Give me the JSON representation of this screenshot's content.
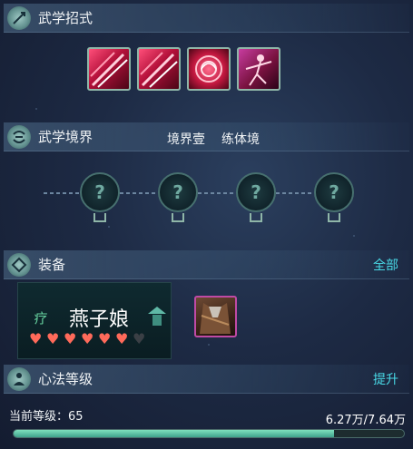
{
  "sections": {
    "martial": {
      "title": "武学招式",
      "icon": "sword-icon"
    },
    "realm": {
      "title": "武学境界",
      "icon": "swirl-icon",
      "realm_name": "境界壹",
      "realm_stage": "练体境"
    },
    "equip": {
      "title": "装备",
      "icon": "emblem-icon",
      "link": "全部"
    },
    "mind": {
      "title": "心法等级",
      "icon": "meditation-icon",
      "link": "提升"
    }
  },
  "skills": [
    {
      "icon": "slash-skill-icon"
    },
    {
      "icon": "slash-skill-icon"
    },
    {
      "icon": "rose-skill-icon"
    },
    {
      "icon": "dancer-skill-icon"
    }
  ],
  "realm_nodes": [
    {
      "icon": "locked-node-icon",
      "glyph": "?"
    },
    {
      "icon": "locked-node-icon",
      "glyph": "?"
    },
    {
      "icon": "locked-node-icon",
      "glyph": "?"
    },
    {
      "icon": "locked-node-icon",
      "glyph": "?"
    }
  ],
  "equipment": {
    "companion_badge": "疗",
    "companion_name": "燕子娘",
    "hearts_filled": 6,
    "hearts_total": 7,
    "item_icon": "robe-item-icon"
  },
  "level": {
    "label": "当前等级：65",
    "progress_text": "6.27万/7.64万",
    "current": 6.27,
    "max": 7.64
  },
  "colors": {
    "accent_link": "#49d9e6",
    "heart_filled": "#ff6a5a",
    "heart_empty": "#3a3f45",
    "bar_fill": "#4fb89a"
  }
}
